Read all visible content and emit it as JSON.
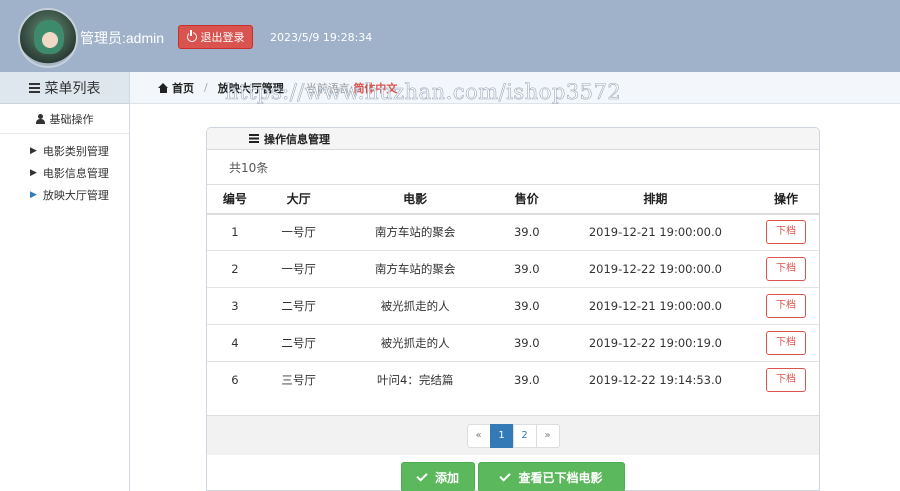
{
  "header": {
    "admin_label": "管理员:admin",
    "logout_label": "退出登录",
    "datetime": "2023/5/9 19:28:34"
  },
  "sidebar": {
    "title": "菜单列表",
    "section": "基础操作",
    "items": [
      {
        "label": "电影类别管理"
      },
      {
        "label": "电影信息管理"
      },
      {
        "label": "放映大厅管理"
      }
    ]
  },
  "breadcrumb": {
    "home": "首页",
    "current": "放映大厅管理",
    "lang_label": "当前语言:",
    "lang_value": "简体中文"
  },
  "watermark": "https://www.huzhan.com/ishop3572",
  "panel": {
    "title": "操作信息管理",
    "count": "共10条",
    "columns": [
      "编号",
      "大厅",
      "电影",
      "售价",
      "排期",
      "操作"
    ],
    "rows": [
      {
        "id": "1",
        "hall": "一号厅",
        "movie": "南方车站的聚会",
        "price": "39.0",
        "schedule": "2019-12-21 19:00:00.0",
        "action": "下档"
      },
      {
        "id": "2",
        "hall": "一号厅",
        "movie": "南方车站的聚会",
        "price": "39.0",
        "schedule": "2019-12-22 19:00:00.0",
        "action": "下档"
      },
      {
        "id": "3",
        "hall": "二号厅",
        "movie": "被光抓走的人",
        "price": "39.0",
        "schedule": "2019-12-21 19:00:00.0",
        "action": "下档"
      },
      {
        "id": "4",
        "hall": "二号厅",
        "movie": "被光抓走的人",
        "price": "39.0",
        "schedule": "2019-12-22 19:00:19.0",
        "action": "下档"
      },
      {
        "id": "6",
        "hall": "三号厅",
        "movie": "叶问4：完结篇",
        "price": "39.0",
        "schedule": "2019-12-22 19:14:53.0",
        "action": "下档"
      }
    ],
    "pagination": {
      "prev": "«",
      "pages": [
        "1",
        "2"
      ],
      "next": "»",
      "current": "1"
    }
  },
  "buttons": {
    "add": "添加",
    "view_removed": "查看已下档电影"
  },
  "colors": {
    "header_bg": "#9fb2c9",
    "danger": "#d9534f",
    "success": "#5cb85c",
    "primary": "#337ab7"
  }
}
